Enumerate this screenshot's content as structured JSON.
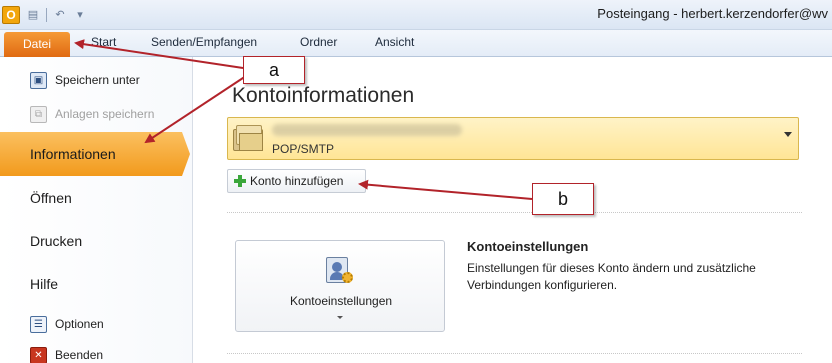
{
  "window": {
    "title": "Posteingang - herbert.kerzendorfer@wv"
  },
  "ribbon": {
    "file_tab": "Datei",
    "tabs": [
      "Start",
      "Senden/Empfangen",
      "Ordner",
      "Ansicht"
    ]
  },
  "nav": {
    "commands_top": [
      {
        "label": "Speichern unter",
        "icon": "save-as-icon",
        "enabled": true
      },
      {
        "label": "Anlagen speichern",
        "icon": "attachments-icon",
        "enabled": false
      }
    ],
    "items": [
      {
        "label": "Informationen",
        "active": true
      },
      {
        "label": "Öffnen",
        "active": false
      },
      {
        "label": "Drucken",
        "active": false
      },
      {
        "label": "Hilfe",
        "active": false
      }
    ],
    "commands_bottom": [
      {
        "label": "Optionen",
        "icon": "options-icon"
      },
      {
        "label": "Beenden",
        "icon": "exit-icon"
      }
    ]
  },
  "main": {
    "title": "Kontoinformationen",
    "account_selector": {
      "account_type": "POP/SMTP"
    },
    "add_account_button": "Konto hinzufügen",
    "account_settings": {
      "button_label": "Kontoeinstellungen",
      "heading": "Kontoeinstellungen",
      "description": "Einstellungen für dieses Konto ändern und zusätzliche Verbindungen konfigurieren."
    }
  },
  "annotations": {
    "a": "a",
    "b": "b",
    "color": "#b2232a"
  }
}
